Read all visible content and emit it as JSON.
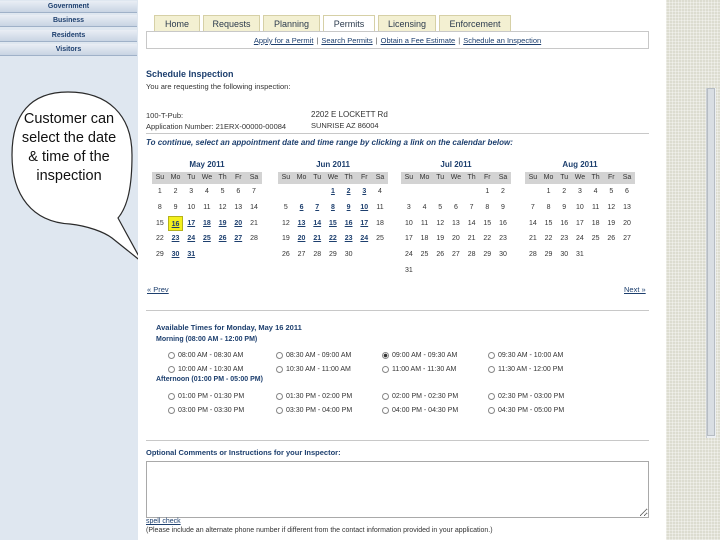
{
  "sidebar": {
    "items": [
      {
        "label": "Government"
      },
      {
        "label": "Business"
      },
      {
        "label": "Residents"
      },
      {
        "label": "Visitors"
      }
    ],
    "callout_text": "Customer can select the date & time of the inspection"
  },
  "tabs": [
    {
      "label": "Home"
    },
    {
      "label": "Requests"
    },
    {
      "label": "Planning"
    },
    {
      "label": "Permits"
    },
    {
      "label": "Licensing"
    },
    {
      "label": "Enforcement"
    }
  ],
  "subnav": [
    {
      "label": "Apply for a Permit"
    },
    {
      "label": "Search Permits"
    },
    {
      "label": "Obtain a Fee Estimate"
    },
    {
      "label": "Schedule an Inspection"
    }
  ],
  "schedule": {
    "title": "Schedule Inspection",
    "intro": "You are requesting the following inspection:",
    "permit_line1": "100-T-Pub:",
    "permit_line2": "Application Number: 21ERX-00000-00084",
    "address_line1": "2202 E LOCKETT Rd",
    "address_line2": "SUNRISE AZ 86004",
    "instruction": "To continue, select an appointment date and time range by clicking a link on the calendar below:",
    "prev": "« Prev",
    "next": "Next »"
  },
  "calendar": {
    "dow": [
      "Su",
      "Mo",
      "Tu",
      "We",
      "Th",
      "Fr",
      "Sa"
    ],
    "months": [
      {
        "title": "May 2011",
        "weeks": [
          [
            "1",
            "2",
            "3",
            "4",
            "5",
            "6",
            "7"
          ],
          [
            "8",
            "9",
            "10",
            "11",
            "12",
            "13",
            "14"
          ],
          [
            "15",
            "16",
            "17",
            "18",
            "19",
            "20",
            "21"
          ],
          [
            "22",
            "23",
            "24",
            "25",
            "26",
            "27",
            "28"
          ],
          [
            "29",
            "30",
            "31",
            "",
            "",
            "",
            ""
          ]
        ],
        "links": [
          "16",
          "17",
          "18",
          "19",
          "20",
          "23",
          "24",
          "25",
          "26",
          "27",
          "30",
          "31"
        ],
        "selected": "16"
      },
      {
        "title": "Jun 2011",
        "weeks": [
          [
            "",
            "",
            "",
            "1",
            "2",
            "3",
            "4"
          ],
          [
            "5",
            "6",
            "7",
            "8",
            "9",
            "10",
            "11"
          ],
          [
            "12",
            "13",
            "14",
            "15",
            "16",
            "17",
            "18"
          ],
          [
            "19",
            "20",
            "21",
            "22",
            "23",
            "24",
            "25"
          ],
          [
            "26",
            "27",
            "28",
            "29",
            "30",
            "",
            ""
          ]
        ],
        "links": [
          "1",
          "2",
          "3",
          "6",
          "7",
          "8",
          "9",
          "10",
          "13",
          "14",
          "15",
          "16",
          "17",
          "20",
          "21",
          "22",
          "23",
          "24"
        ]
      },
      {
        "title": "Jul 2011",
        "weeks": [
          [
            "",
            "",
            "",
            "",
            "",
            "1",
            "2"
          ],
          [
            "3",
            "4",
            "5",
            "6",
            "7",
            "8",
            "9"
          ],
          [
            "10",
            "11",
            "12",
            "13",
            "14",
            "15",
            "16"
          ],
          [
            "17",
            "18",
            "19",
            "20",
            "21",
            "22",
            "23"
          ],
          [
            "24",
            "25",
            "26",
            "27",
            "28",
            "29",
            "30"
          ],
          [
            "31",
            "",
            "",
            "",
            "",
            "",
            ""
          ]
        ],
        "links": []
      },
      {
        "title": "Aug 2011",
        "weeks": [
          [
            "",
            "1",
            "2",
            "3",
            "4",
            "5",
            "6"
          ],
          [
            "7",
            "8",
            "9",
            "10",
            "11",
            "12",
            "13"
          ],
          [
            "14",
            "15",
            "16",
            "17",
            "18",
            "19",
            "20"
          ],
          [
            "21",
            "22",
            "23",
            "24",
            "25",
            "26",
            "27"
          ],
          [
            "28",
            "29",
            "30",
            "31",
            "",
            "",
            ""
          ]
        ],
        "links": []
      }
    ]
  },
  "times": {
    "title": "Available Times for Monday, May 16 2011",
    "morning_label": "Morning (08:00 AM - 12:00 PM)",
    "afternoon_label": "Afternoon (01:00 PM - 05:00 PM)",
    "morning_row1": [
      "08:00 AM - 08:30 AM",
      "08:30 AM - 09:00 AM",
      "09:00 AM - 09:30 AM",
      "09:30 AM - 10:00 AM"
    ],
    "morning_row2": [
      "10:00 AM - 10:30 AM",
      "10:30 AM - 11:00 AM",
      "11:00 AM - 11:30 AM",
      "11:30 AM - 12:00 PM"
    ],
    "afternoon_row1": [
      "01:00 PM - 01:30 PM",
      "01:30 PM - 02:00 PM",
      "02:00 PM - 02:30 PM",
      "02:30 PM - 03:00 PM"
    ],
    "afternoon_row2": [
      "03:00 PM - 03:30 PM",
      "03:30 PM - 04:00 PM",
      "04:00 PM - 04:30 PM",
      "04:30 PM - 05:00 PM"
    ],
    "selected": "09:00 AM - 09:30 AM"
  },
  "comments": {
    "label": "Optional Comments or Instructions for your Inspector:",
    "spell_check": "spell check",
    "note": "(Please include an alternate phone number if different from the contact information provided in your application.)"
  }
}
